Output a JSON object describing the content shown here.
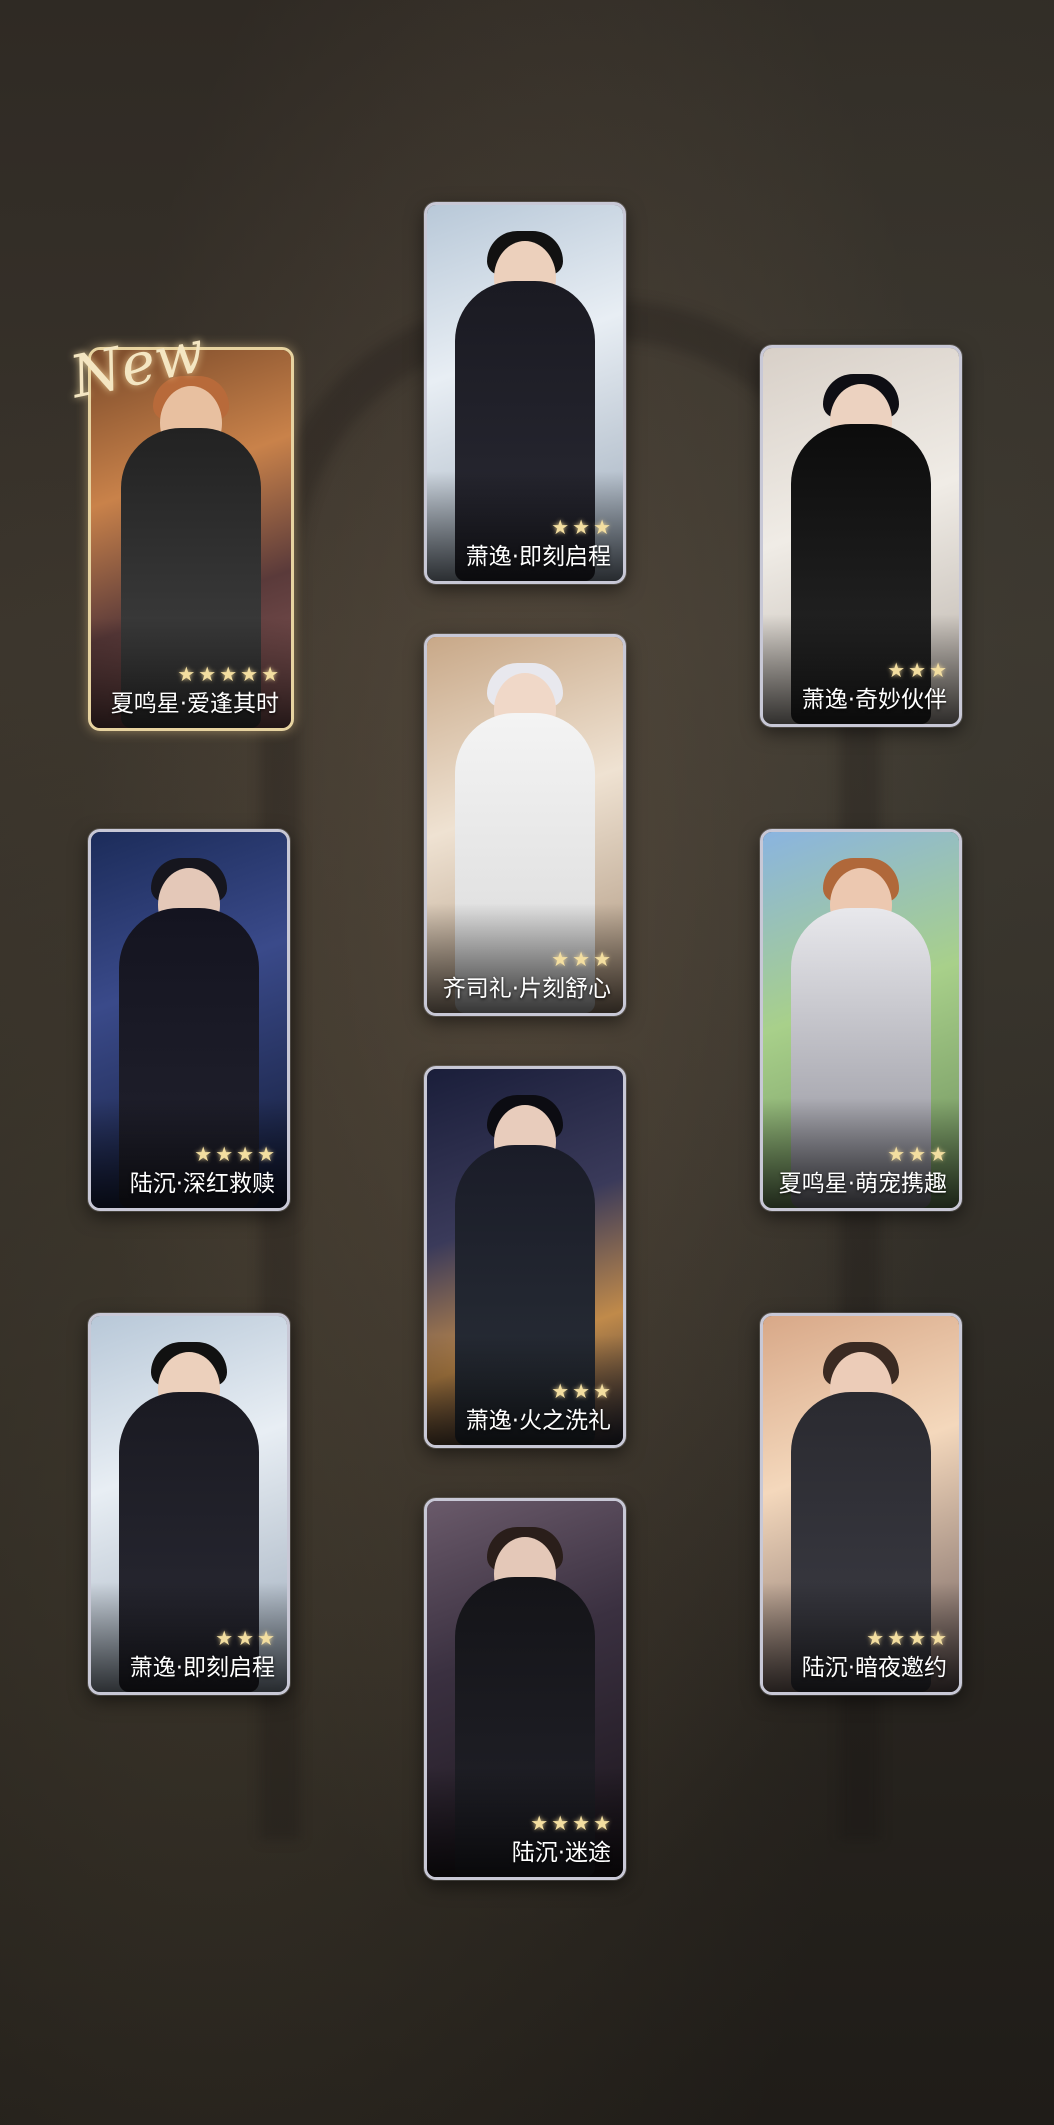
{
  "new_badge": "New",
  "cards": [
    {
      "label": "夏鸣星·爱逢其时",
      "stars": 5,
      "rarity": "gold"
    },
    {
      "label": "萧逸·即刻启程",
      "stars": 3
    },
    {
      "label": "萧逸·奇妙伙伴",
      "stars": 3
    },
    {
      "label": "齐司礼·片刻舒心",
      "stars": 3
    },
    {
      "label": "陆沉·深红救赎",
      "stars": 4
    },
    {
      "label": "夏鸣星·萌宠携趣",
      "stars": 3
    },
    {
      "label": "萧逸·火之洗礼",
      "stars": 3
    },
    {
      "label": "萧逸·即刻启程",
      "stars": 3
    },
    {
      "label": "陆沉·暗夜邀约",
      "stars": 4
    },
    {
      "label": "陆沉·迷途",
      "stars": 4
    }
  ],
  "colors": {
    "card_border": "#c8c8d6",
    "gold_border": "#e7d3a0",
    "star": "#f3dea0"
  }
}
